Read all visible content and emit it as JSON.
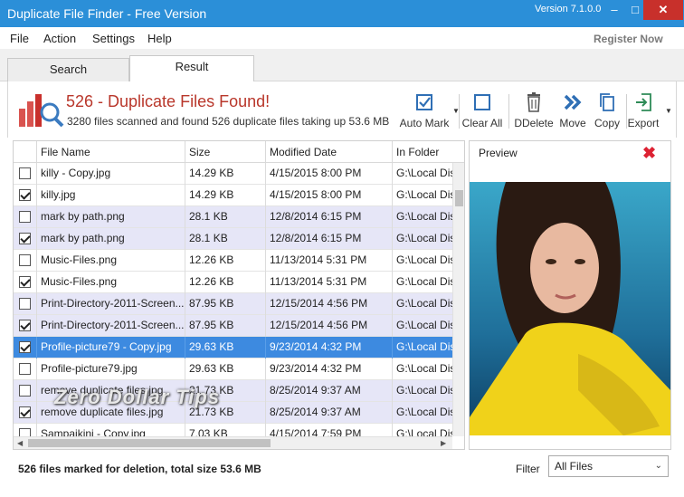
{
  "window": {
    "title": "Duplicate File Finder - Free Version",
    "version": "Version 7.1.0.0",
    "min_glyph": "–",
    "max_glyph": "□",
    "close_glyph": "✕"
  },
  "menu": [
    "File",
    "Action",
    "Settings",
    "Help"
  ],
  "register_label": "Register Now",
  "tabs": {
    "search": "Search",
    "result": "Result"
  },
  "summary": {
    "title": "526 - Duplicate Files Found!",
    "subtitle": "3280 files scanned and found 526 duplicate files taking up 53.6 MB"
  },
  "toolbar": {
    "auto_mark": "Auto Mark",
    "clear_all": "Clear All",
    "ddelete": "DDelete",
    "move": "Move",
    "copy": "Copy",
    "export": "Export"
  },
  "columns": {
    "name": "File Name",
    "size": "Size",
    "modified": "Modified Date",
    "folder": "In Folder"
  },
  "rows": [
    {
      "checked": false,
      "name": "killy - Copy.jpg",
      "size": "14.29 KB",
      "date": "4/15/2015 8:00 PM",
      "folder": "G:\\Local Disk"
    },
    {
      "checked": true,
      "name": "killy.jpg",
      "size": "14.29 KB",
      "date": "4/15/2015 8:00 PM",
      "folder": "G:\\Local Disk"
    },
    {
      "checked": false,
      "name": "mark by path.png",
      "size": "28.1 KB",
      "date": "12/8/2014 6:15 PM",
      "folder": "G:\\Local Disk"
    },
    {
      "checked": true,
      "name": "mark by path.png",
      "size": "28.1 KB",
      "date": "12/8/2014 6:15 PM",
      "folder": "G:\\Local Disk"
    },
    {
      "checked": false,
      "name": "Music-Files.png",
      "size": "12.26 KB",
      "date": "11/13/2014 5:31 PM",
      "folder": "G:\\Local Disk"
    },
    {
      "checked": true,
      "name": "Music-Files.png",
      "size": "12.26 KB",
      "date": "11/13/2014 5:31 PM",
      "folder": "G:\\Local Disk"
    },
    {
      "checked": false,
      "name": "Print-Directory-2011-Screen...",
      "size": "87.95 KB",
      "date": "12/15/2014 4:56 PM",
      "folder": "G:\\Local Disk"
    },
    {
      "checked": true,
      "name": "Print-Directory-2011-Screen...",
      "size": "87.95 KB",
      "date": "12/15/2014 4:56 PM",
      "folder": "G:\\Local Disk"
    },
    {
      "checked": true,
      "name": "Profile-picture79 - Copy.jpg",
      "size": "29.63 KB",
      "date": "9/23/2014 4:32 PM",
      "folder": "G:\\Local Disk"
    },
    {
      "checked": false,
      "name": "Profile-picture79.jpg",
      "size": "29.63 KB",
      "date": "9/23/2014 4:32 PM",
      "folder": "G:\\Local Disk"
    },
    {
      "checked": false,
      "name": "remove duplicate files.jpg",
      "size": "21.73 KB",
      "date": "8/25/2014 9:37 AM",
      "folder": "G:\\Local Disk"
    },
    {
      "checked": true,
      "name": "remove duplicate files.jpg",
      "size": "21.73 KB",
      "date": "8/25/2014 9:37 AM",
      "folder": "G:\\Local Disk"
    },
    {
      "checked": false,
      "name": "Sampaikini - Copy.jpg",
      "size": "7.03 KB",
      "date": "4/15/2014 7:59 PM",
      "folder": "G:\\Local Disk"
    }
  ],
  "selected_row": "Profile-picture79 - Copy.jpg",
  "preview": {
    "title": "Preview",
    "close_glyph": "✖"
  },
  "status": {
    "text": "526 files marked for deletion, total size 53.6 MB",
    "filter_label": "Filter",
    "filter_value": "All Files"
  },
  "watermark": "Zero Dollar Tips",
  "colors": {
    "titlebar": "#2b8fd8",
    "accent_red": "#b9372b",
    "selection": "#3d8ae0",
    "alt_row": "#e6e6f7"
  }
}
